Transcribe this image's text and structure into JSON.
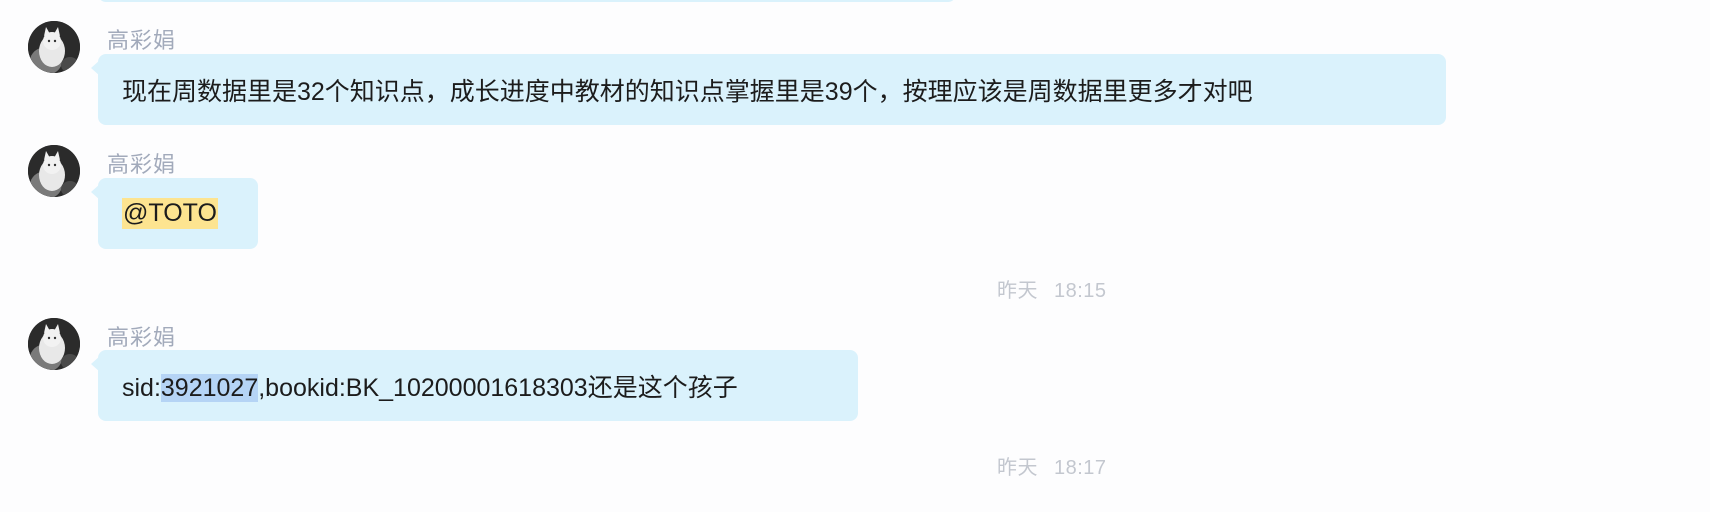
{
  "messages": [
    {
      "sender": "高彩娟",
      "text": "现在周数据里是32个知识点，成长进度中教材的知识点掌握里是39个，按理应该是周数据里更多才对吧"
    },
    {
      "sender": "高彩娟",
      "mention": "@TOTO"
    },
    {
      "sender": "高彩娟",
      "text_prefix": "sid:",
      "text_selected": "3921027",
      "text_suffix": ",bookid:BK_10200001618303还是这个孩子"
    }
  ],
  "timestamps": [
    {
      "day": "昨天",
      "time": "18:15"
    },
    {
      "day": "昨天",
      "time": "18:17"
    }
  ],
  "colors": {
    "bubble": "#daf2fc",
    "sender_name": "#a2aabb",
    "timestamp": "#c3c7cf",
    "mention_highlight": "#fde490",
    "text_selection": "#b5d4f5"
  }
}
